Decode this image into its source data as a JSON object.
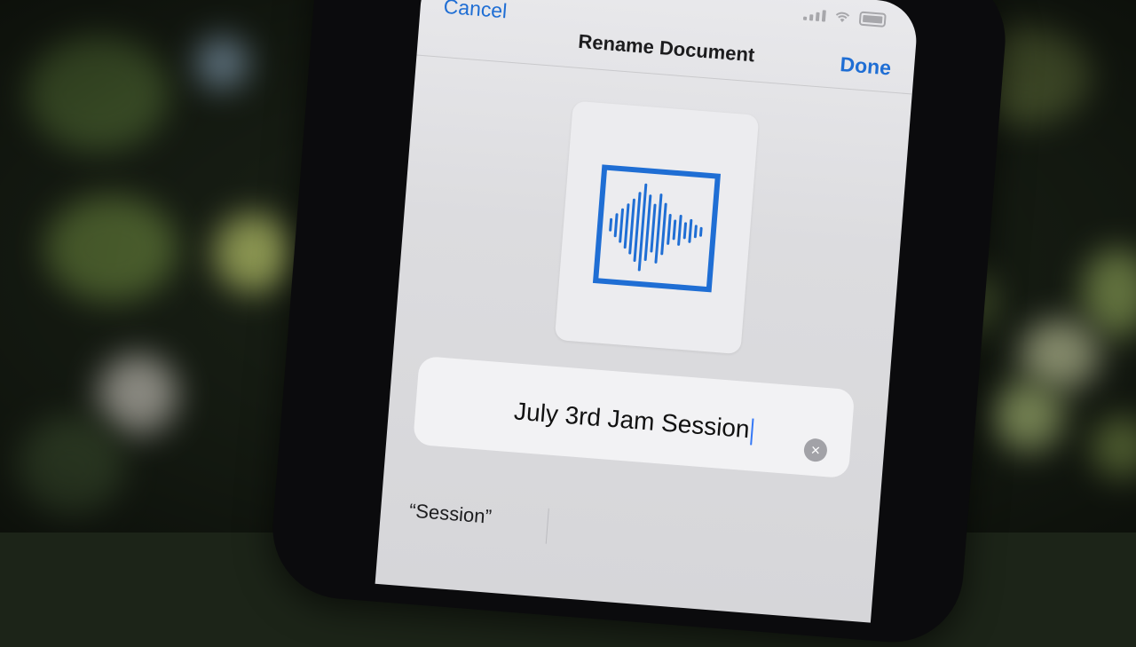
{
  "navbar": {
    "cancel_label": "Cancel",
    "title": "Rename Document",
    "done_label": "Done"
  },
  "document": {
    "icon": "waveform-icon",
    "name": "July 3rd Jam Session"
  },
  "keyboard": {
    "suggestions": [
      "“Session”"
    ]
  },
  "colors": {
    "accent": "#1f6ed4",
    "waveform": "#1f6ed4",
    "screen_bg": "#e4e4e7",
    "field_bg": "#f2f2f4"
  }
}
